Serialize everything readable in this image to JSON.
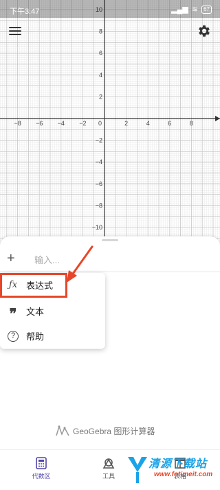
{
  "status_bar": {
    "time": "下午3:47",
    "battery": "67"
  },
  "graph": {
    "x_ticks": [
      "−8",
      "−6",
      "−4",
      "−2",
      "0",
      "2",
      "4",
      "6",
      "8"
    ],
    "y_ticks": [
      "10",
      "8",
      "6",
      "4",
      "2",
      "−2",
      "−4",
      "−6",
      "−8",
      "−10"
    ]
  },
  "input": {
    "placeholder": "输入..."
  },
  "popup_menu": {
    "items": [
      {
        "icon": "fx-icon",
        "label": "表达式"
      },
      {
        "icon": "quote-icon",
        "label": "文本"
      },
      {
        "icon": "help-icon",
        "label": "帮助"
      }
    ]
  },
  "brand": {
    "text": "GeoGebra 图形计算器"
  },
  "bottom_nav": [
    {
      "label": "代数区",
      "icon": "calculator-icon",
      "active": true
    },
    {
      "label": "工具",
      "icon": "tools-icon",
      "active": false
    },
    {
      "label": "表格",
      "icon": "table-icon",
      "active": false
    }
  ],
  "watermark": {
    "text": "清源下载站",
    "url": "www.fotimeit.com"
  },
  "colors": {
    "accent": "#5145a8",
    "highlight": "#e8462a"
  }
}
